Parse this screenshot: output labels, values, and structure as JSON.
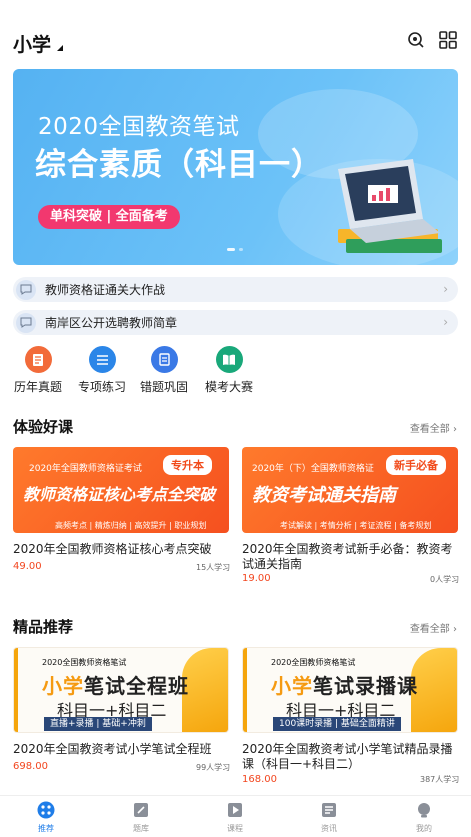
{
  "header": {
    "grade": "小学"
  },
  "banner": {
    "line1": "2020全国教资笔试",
    "line2": "综合素质（科目一）",
    "tag": "单科突破 | 全面备考"
  },
  "notices": [
    {
      "text": "教师资格证通关大作战"
    },
    {
      "text": "南岸区公开选聘教师简章"
    }
  ],
  "quick_links": [
    {
      "label": "历年真题",
      "icon": "exam-paper-icon",
      "color": "#f26b3a"
    },
    {
      "label": "专项练习",
      "icon": "list-icon",
      "color": "#2b86e8"
    },
    {
      "label": "错题巩固",
      "icon": "notebook-icon",
      "color": "#3a79e6"
    },
    {
      "label": "模考大赛",
      "icon": "book-icon",
      "color": "#19a87a"
    }
  ],
  "section_trial": {
    "title": "体验好课",
    "more": "查看全部",
    "courses": [
      {
        "img_small": "2020年全国教师资格证考试",
        "img_badge": "专升本",
        "img_big": "教师资格证核心考点全突破",
        "img_line3": "高频考点 | 精炼归纳 | 高效提升 | 职业规划",
        "title": "2020年全国教师资格证核心考点突破",
        "price": "49.00",
        "learners": "15人学习"
      },
      {
        "img_small": "2020年（下）全国教师资格证",
        "img_badge": "新手必备",
        "img_big": "教资考试通关指南",
        "img_line3": "考试解读 | 考情分析 | 考证流程 | 备考规划",
        "title": "2020年全国教资考试新手必备：教资考试通关指南",
        "price": "19.00",
        "learners": "0人学习"
      }
    ]
  },
  "section_featured": {
    "title": "精品推荐",
    "more": "查看全部",
    "courses": [
      {
        "img_head": "2020全国教师资格笔试",
        "img_main_accent": "小学",
        "img_main_rest": "笔试全程班",
        "img_sub": "科目一+科目二",
        "img_bar": "直播+录播 | 基础+冲刺",
        "title": "2020年全国教资考试小学笔试全程班",
        "price": "698.00",
        "learners": "99人学习"
      },
      {
        "img_head": "2020全国教师资格笔试",
        "img_main_accent": "小学",
        "img_main_rest": "笔试录播课",
        "img_sub": "科目一+科目二",
        "img_bar": "100课时录播 | 基础全面精讲",
        "title": "2020年全国教资考试小学笔试精品录播课（科目一+科目二）",
        "price": "168.00",
        "learners": "387人学习"
      }
    ]
  },
  "tabbar": [
    {
      "label": "推荐",
      "icon": "home-icon",
      "active": true
    },
    {
      "label": "题库",
      "icon": "edit-icon",
      "active": false
    },
    {
      "label": "课程",
      "icon": "play-icon",
      "active": false
    },
    {
      "label": "资讯",
      "icon": "news-icon",
      "active": false
    },
    {
      "label": "我的",
      "icon": "user-icon",
      "active": false
    }
  ],
  "colors": {
    "accent": "#1f7de8",
    "price": "#f2461f",
    "tag": "#f2386f",
    "banner": "#5fb8f5"
  }
}
